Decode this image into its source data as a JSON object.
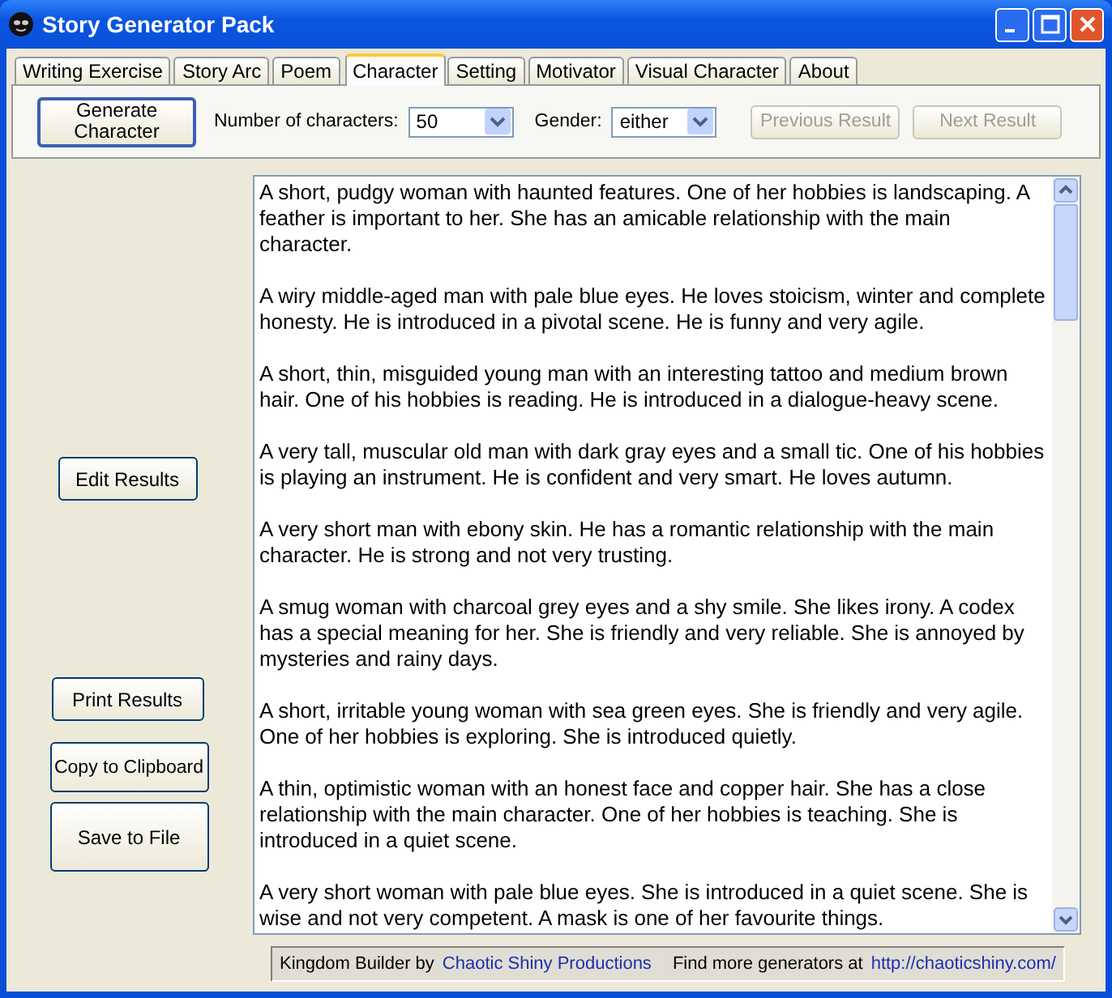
{
  "window": {
    "title": "Story Generator Pack"
  },
  "tabs": [
    {
      "label": "Writing Exercise",
      "selected": false
    },
    {
      "label": "Story Arc",
      "selected": false
    },
    {
      "label": "Poem",
      "selected": false
    },
    {
      "label": "Character",
      "selected": true
    },
    {
      "label": "Setting",
      "selected": false
    },
    {
      "label": "Motivator",
      "selected": false
    },
    {
      "label": "Visual Character",
      "selected": false
    },
    {
      "label": "About",
      "selected": false
    }
  ],
  "toolbar": {
    "generate_button": "Generate Character",
    "count_label": "Number of characters:",
    "count_value": "50",
    "gender_label": "Gender:",
    "gender_value": "either",
    "nav_buttons": [
      {
        "label": "Previous Result",
        "disabled": true
      },
      {
        "label": "Next Result",
        "disabled": true
      }
    ]
  },
  "side_buttons": [
    "Edit Results",
    "Print Results",
    "Copy to Clipboard",
    "Save to File"
  ],
  "results": [
    "A short, pudgy woman with haunted features. One of her hobbies is landscaping. A feather is important to her. She has an amicable relationship with the main character.",
    "A wiry middle-aged man with pale blue eyes. He loves stoicism, winter and complete honesty. He is introduced in a pivotal scene. He is funny and very agile.",
    "A short, thin, misguided young man with an interesting tattoo and medium brown hair. One of his hobbies is reading. He is introduced in a dialogue-heavy scene.",
    "A very tall, muscular old man with dark gray eyes and a small tic. One of his hobbies is playing an instrument. He is confident and very smart. He loves autumn.",
    "A very short man with ebony skin. He has a romantic relationship with the main character. He is strong and  not very trusting.",
    "A smug woman with charcoal grey eyes and a shy smile. She likes irony. A codex has a special meaning for her. She is friendly and very reliable. She is annoyed by mysteries and rainy days.",
    "A short, irritable young woman with sea green eyes. She is friendly and very agile. One of her hobbies is exploring. She is introduced quietly.",
    "A thin, optimistic woman with an honest face and copper hair. She has a close relationship with the main character. One of her hobbies is teaching. She is introduced in a quiet scene.",
    "A very short woman with pale blue eyes. She is introduced in a quiet scene. She is wise and  not very competent. A mask is one of her favourite things."
  ],
  "footer": {
    "credit_text": "Kingdom Builder by",
    "credit_link": "Chaotic Shiny Productions",
    "more_text": "Find more generators at",
    "more_link": "http://chaoticshiny.com/"
  }
}
